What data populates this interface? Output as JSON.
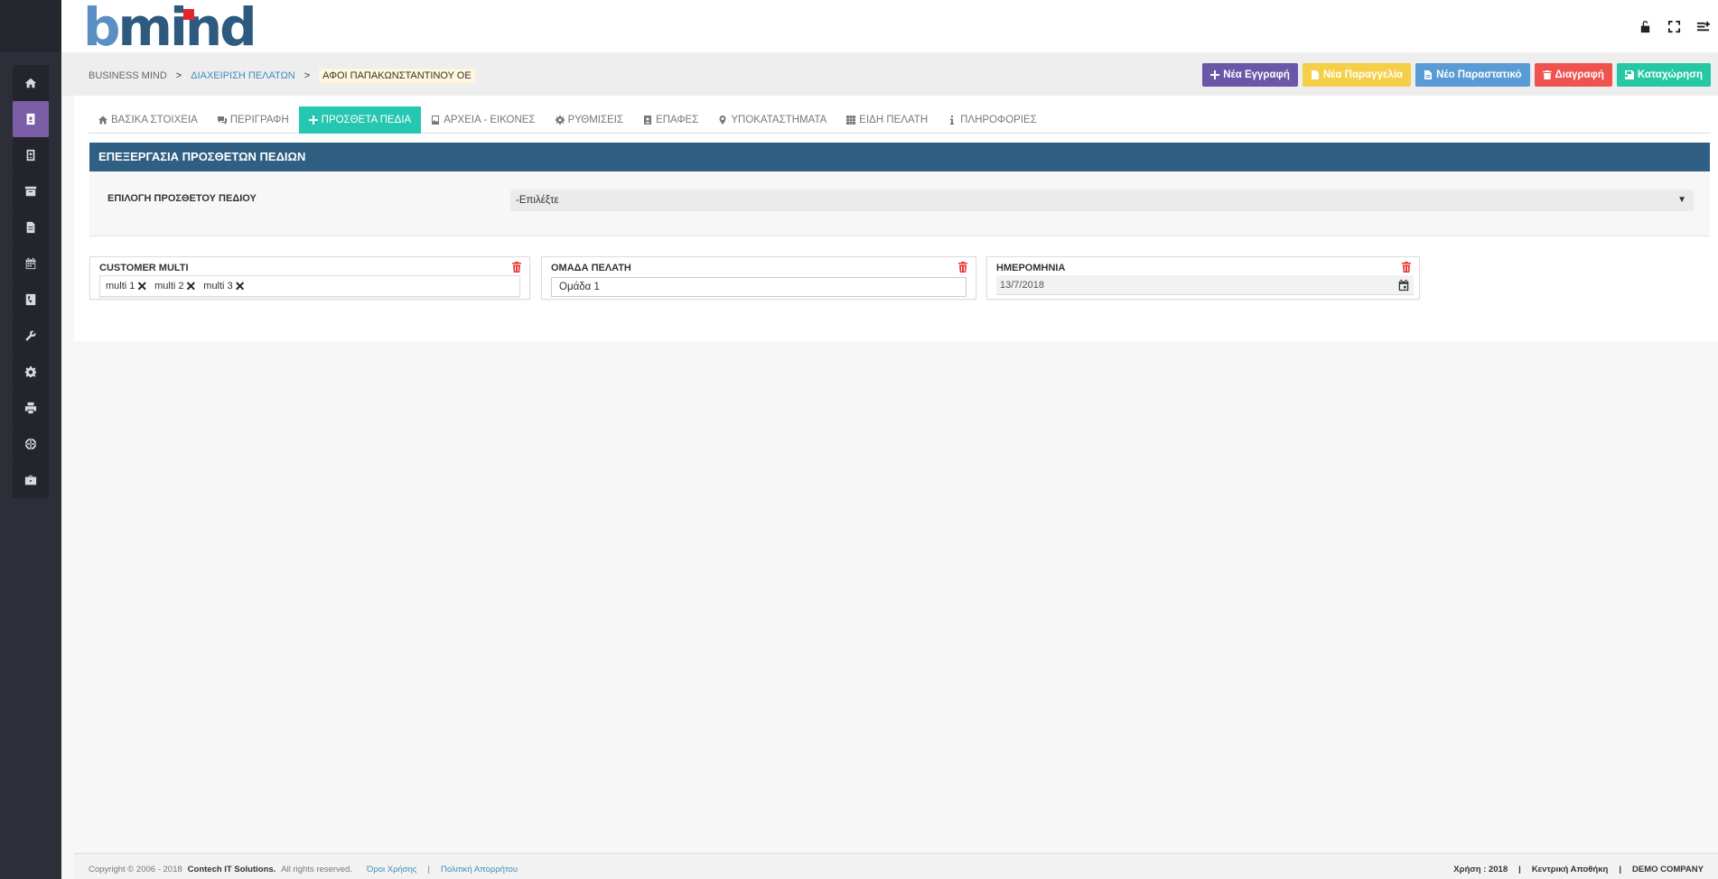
{
  "app": {
    "logo_b": "b",
    "logo_rest": "mind"
  },
  "breadcrumb": {
    "items": [
      "BUSINESS MIND",
      "ΔΙΑΧΕΙΡΙΣΗ ΠΕΛΑΤΩΝ",
      "ΑΦΟΙ ΠΑΠΑΚΩΝΣΤΑΝΤΙΝΟΥ ΟΕ"
    ],
    "separator": ">"
  },
  "actions": {
    "new_record": "Νέα Εγγραφή",
    "new_order": "Νέα Παραγγελία",
    "new_document": "Νέο Παραστατικό",
    "delete": "Διαγραφή",
    "save": "Καταχώρηση"
  },
  "tabs": [
    {
      "label": "ΒΑΣΙΚΑ ΣΤΟΙΧΕΙΑ",
      "icon": "home-icon"
    },
    {
      "label": "ΠΕΡΙΓΡΑΦΗ",
      "icon": "comments-icon"
    },
    {
      "label": "ΠΡΟΣΘΕΤΑ ΠΕΔΙΑ",
      "icon": "plus-icon",
      "active": true
    },
    {
      "label": "ΑΡΧΕΙΑ - ΕΙΚΟΝΕΣ",
      "icon": "image-file-icon"
    },
    {
      "label": "ΡΥΘΜΙΣΕΙΣ",
      "icon": "gear-icon"
    },
    {
      "label": "ΕΠΑΦΕΣ",
      "icon": "contact-icon"
    },
    {
      "label": "ΥΠΟΚΑΤΑΣΤΗΜΑΤΑ",
      "icon": "map-marker-icon"
    },
    {
      "label": "ΕΙΔΗ ΠΕΛΑΤΗ",
      "icon": "grid-icon"
    },
    {
      "label": "ΠΛΗΡΟΦΟΡΙΕΣ",
      "icon": "info-icon"
    }
  ],
  "panel": {
    "title": "ΕΠΕΞΕΡΓΑΣΙΑ ΠΡΟΣΘΕΤΩΝ ΠΕΔΙΩΝ",
    "select_label": "ΕΠΙΛΟΓΗ ΠΡΟΣΘΕΤΟΥ ΠΕΔΙΟΥ",
    "select_value": "-Επιλέξτε"
  },
  "fields": {
    "customer_multi": {
      "title": "CUSTOMER MULTI",
      "tags": [
        "multi 1",
        "multi 2",
        "multi 3"
      ]
    },
    "customer_group": {
      "title": "ΟΜΑΔΑ ΠΕΛΑΤΗ",
      "value": "Ομάδα 1"
    },
    "date": {
      "title": "ΗΜΕΡΟΜΗΝΙΑ",
      "value": "13/7/2018"
    }
  },
  "footer": {
    "copyright": "Copyright © 2006 - 2018",
    "company": "Contech IT Solutions.",
    "rights": "All rights reserved.",
    "terms": "Όροι Χρήσης",
    "privacy": "Πολιτική Απορρήτου",
    "divider": "|",
    "year": "Χρήση : 2018",
    "warehouse": "Κεντρική Αποθήκη",
    "company_name": "DEMO COMPANY"
  },
  "sidebar": {
    "items": [
      "home-icon",
      "address-card-icon",
      "contact-book-icon",
      "archive-icon",
      "document-icon",
      "calendar-icon",
      "phone-icon",
      "wrench-icon",
      "gear-icon",
      "print-icon",
      "globe-icon",
      "briefcase-icon"
    ],
    "active_index": 1
  },
  "colors": {
    "sidebar": "#2c2f38",
    "active_sidebar": "#7b5ea7",
    "panel_header": "#2f5f82",
    "active_tab": "#26c7b0",
    "delete_icon": "#e53935"
  }
}
